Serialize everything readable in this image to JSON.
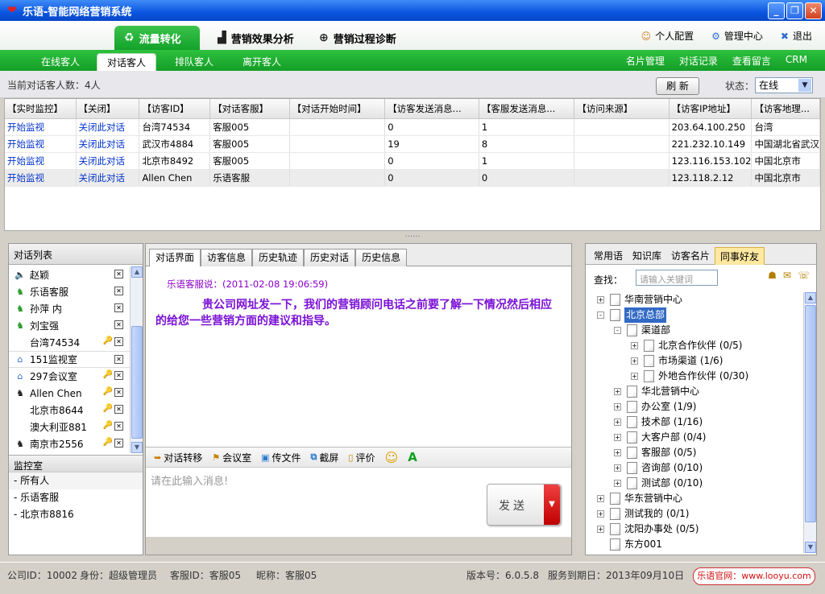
{
  "window": {
    "title": "乐语-智能网络营销系统"
  },
  "top_tabs": [
    {
      "label": "流量转化",
      "icon": "recycle-icon",
      "active": true
    },
    {
      "label": "营销效果分析",
      "icon": "chart-icon"
    },
    {
      "label": "营销过程诊断",
      "icon": "plus-circle-icon"
    }
  ],
  "top_links": [
    {
      "label": "个人配置",
      "icon": "user-icon"
    },
    {
      "label": "管理中心",
      "icon": "gear-icon"
    },
    {
      "label": "退出",
      "icon": "close-icon"
    }
  ],
  "sub_tabs": [
    "在线客人",
    "对话客人",
    "排队客人",
    "离开客人"
  ],
  "sub_tab_active": "对话客人",
  "right_links": [
    "名片管理",
    "对话记录",
    "查看留言",
    "CRM"
  ],
  "status": {
    "count_text": "当前对话客人数：4人",
    "refresh_label": "刷 新",
    "state_label": "状态：",
    "state_value": "在线"
  },
  "table": {
    "columns": [
      "【实时监控】",
      "【关闭】",
      "【访客ID】",
      "【对话客服】",
      "【对话开始时间】",
      "【访客发送消息...",
      "【客服发送消息...",
      "【访问来源】",
      "【访客IP地址】",
      "【访客地理..."
    ],
    "rows": [
      [
        "开始监视",
        "关闭此对话",
        "台湾74534",
        "客服005",
        "",
        "0",
        "1",
        "",
        "203.64.100.250",
        "台湾"
      ],
      [
        "开始监视",
        "关闭此对话",
        "武汉市4884",
        "客服005",
        "",
        "19",
        "8",
        "",
        "221.232.10.149",
        "中国湖北省武汉"
      ],
      [
        "开始监视",
        "关闭此对话",
        "北京市8492",
        "客服005",
        "",
        "0",
        "1",
        "",
        "123.116.153.102",
        "中国北京市"
      ],
      [
        "开始监视",
        "关闭此对话",
        "Allen Chen",
        "乐语客服",
        "",
        "0",
        "0",
        "",
        "123.118.2.12",
        "中国北京市"
      ]
    ]
  },
  "splitter_grip": "......",
  "chat_list": {
    "title": "对话列表",
    "items": [
      {
        "label": "赵颖",
        "icon": "speaker-icon"
      },
      {
        "label": "乐语客服",
        "icon": "green-user-icon"
      },
      {
        "label": "孙萍 内",
        "icon": "green-user-icon"
      },
      {
        "label": "刘宝强",
        "icon": "green-user-icon"
      },
      {
        "label": "台湾74534",
        "icon": ""
      },
      {
        "label": "151监视室",
        "icon": "home-icon"
      },
      {
        "label": "297会议室",
        "icon": "home-icon"
      },
      {
        "label": "Allen Chen",
        "icon": "black-user-icon"
      },
      {
        "label": "北京市8644",
        "icon": ""
      },
      {
        "label": "澳大利亚881",
        "icon": ""
      },
      {
        "label": "南京市2556",
        "icon": "black-user-icon"
      }
    ]
  },
  "monitor": {
    "title": "监控室",
    "items": [
      "所有人",
      "乐语客服",
      "北京市8816"
    ]
  },
  "center_tabs": [
    "对话界面",
    "访客信息",
    "历史轨迹",
    "历史对话",
    "历史信息"
  ],
  "message": {
    "sender": "乐语客服说：",
    "time": "(2011-02-08 19:06:59)",
    "text": "贵公司网址发一下，我们的营销顾问电话之前要了解一下情况然后相应的给您一些营销方面的建议和指导。"
  },
  "chat_toolbar": [
    "对话转移",
    "会议室",
    "传文件",
    "截屏",
    "评价"
  ],
  "input": {
    "placeholder": "请在此输入消息!"
  },
  "send_label": "发送",
  "right_tabs": [
    "常用语",
    "知识库",
    "访客名片",
    "同事好友"
  ],
  "right_tab_active": "同事好友",
  "search": {
    "label": "查找：",
    "placeholder": "请输入关键词"
  },
  "tree": [
    {
      "label": "华南营销中心",
      "level": 0,
      "toggle": "+"
    },
    {
      "label": "北京总部",
      "level": 0,
      "toggle": "-",
      "selected": true
    },
    {
      "label": "渠道部",
      "level": 1,
      "toggle": "-"
    },
    {
      "label": "北京合作伙伴 (0/5)",
      "level": 2,
      "toggle": "+"
    },
    {
      "label": "市场渠道 (1/6)",
      "level": 2,
      "toggle": "+"
    },
    {
      "label": "外地合作伙伴 (0/30)",
      "level": 2,
      "toggle": "+"
    },
    {
      "label": "华北营销中心",
      "level": 1,
      "toggle": "+"
    },
    {
      "label": "办公室 (1/9)",
      "level": 1,
      "toggle": "+"
    },
    {
      "label": "技术部 (1/16)",
      "level": 1,
      "toggle": "+"
    },
    {
      "label": "大客户部 (0/4)",
      "level": 1,
      "toggle": "+"
    },
    {
      "label": "客服部 (0/5)",
      "level": 1,
      "toggle": "+"
    },
    {
      "label": "咨询部 (0/10)",
      "level": 1,
      "toggle": "+"
    },
    {
      "label": "测试部 (0/10)",
      "level": 1,
      "toggle": "+"
    },
    {
      "label": "华东营销中心",
      "level": 0,
      "toggle": "+"
    },
    {
      "label": "测试我的 (0/1)",
      "level": 0,
      "toggle": "+"
    },
    {
      "label": "沈阳办事处 (0/5)",
      "level": 0,
      "toggle": "+"
    },
    {
      "label": "东方001",
      "level": 0,
      "toggle": ""
    }
  ],
  "statusbar": {
    "company_id": "公司ID：10002",
    "role": "身份：超级管理员",
    "service_id": "客服ID：客服05",
    "nickname": "昵称：客服05",
    "version": "版本号：6.0.5.8",
    "expire": "服务到期日：2013年09月10日",
    "brand": "乐语官网：www.looyu.com"
  }
}
